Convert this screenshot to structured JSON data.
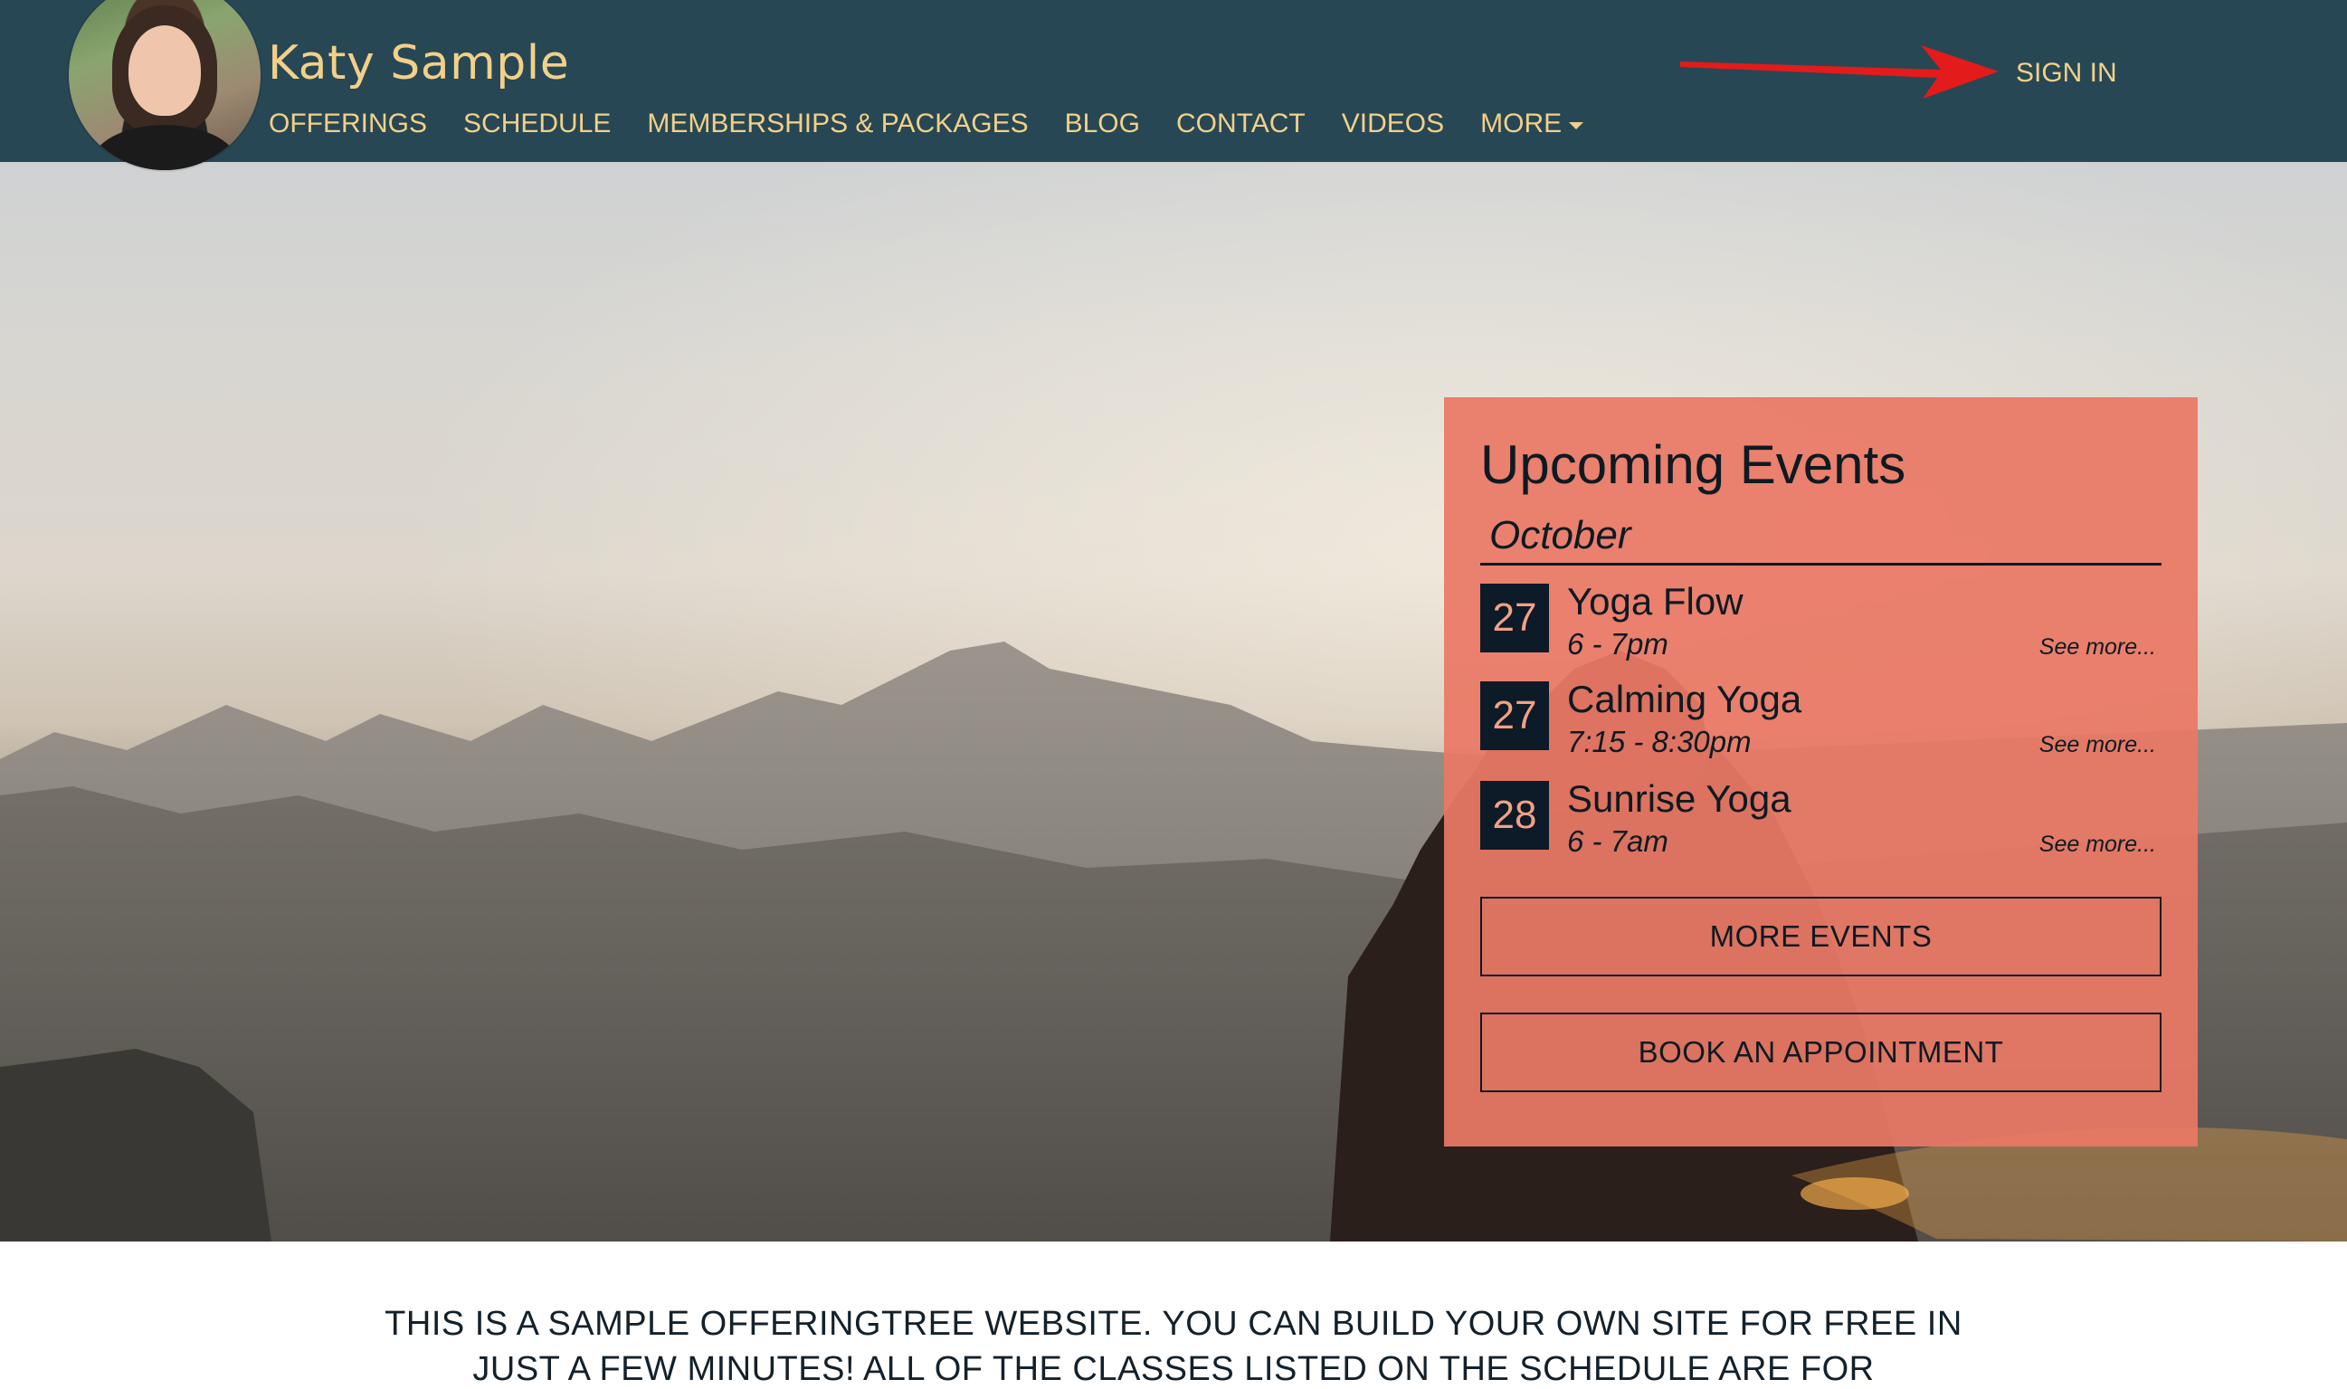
{
  "header": {
    "site_title": "Katy Sample",
    "sign_in_label": "SIGN IN",
    "nav": [
      {
        "label": "OFFERINGS"
      },
      {
        "label": "SCHEDULE"
      },
      {
        "label": "MEMBERSHIPS & PACKAGES"
      },
      {
        "label": "BLOG"
      },
      {
        "label": "CONTACT"
      },
      {
        "label": "VIDEOS"
      },
      {
        "label": "MORE"
      }
    ],
    "more_icon": "caret-down-icon",
    "annotation_icon": "red-arrow-icon",
    "avatar_icon": "profile-photo"
  },
  "events": {
    "title": "Upcoming Events",
    "month": "October",
    "items": [
      {
        "day": "27",
        "name": "Yoga Flow",
        "time": "6 - 7pm",
        "see_more": "See more..."
      },
      {
        "day": "27",
        "name": "Calming Yoga",
        "time": "7:15 - 8:30pm",
        "see_more": "See more..."
      },
      {
        "day": "28",
        "name": "Sunrise Yoga",
        "time": "6 - 7am",
        "see_more": "See more..."
      }
    ],
    "more_events_label": "MORE EVENTS",
    "book_label": "BOOK AN APPOINTMENT"
  },
  "intro": {
    "line1": "THIS IS A SAMPLE OFFERINGTREE WEBSITE. YOU CAN BUILD YOUR OWN SITE FOR FREE IN",
    "line2": "JUST A FEW MINUTES! ALL OF THE CLASSES LISTED ON THE SCHEDULE ARE FOR"
  },
  "colors": {
    "header_bg": "#274754",
    "accent_gold": "#f2d089",
    "panel_bg": "#e97965",
    "date_box_bg": "#0d1a27",
    "annotation_red": "#e41b1b"
  }
}
